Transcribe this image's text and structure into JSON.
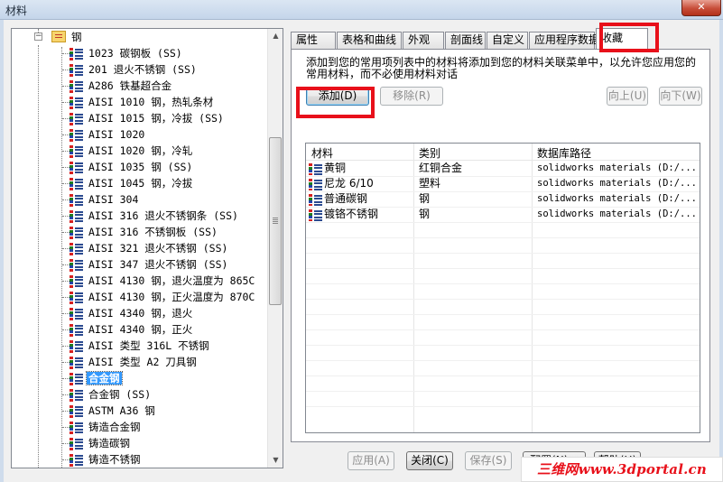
{
  "window": {
    "title": "材料",
    "close_glyph": "✕"
  },
  "tree": {
    "root": {
      "label": "钢",
      "icon": "folder-icon"
    },
    "items": [
      "1023 碳钢板 (SS)",
      "201 退火不锈钢 (SS)",
      "A286 铁基超合金",
      "AISI 1010 钢，热轧条材",
      "AISI 1015 钢，冷拔 (SS)",
      "AISI 1020",
      "AISI 1020 钢，冷轧",
      "AISI 1035 钢 (SS)",
      "AISI 1045 钢，冷拔",
      "AISI 304",
      "AISI 316 退火不锈钢条 (SS)",
      "AISI 316 不锈钢板 (SS)",
      "AISI 321 退火不锈钢 (SS)",
      "AISI 347 退火不锈钢 (SS)",
      "AISI 4130 钢，退火温度为 865C",
      "AISI 4130 钢，正火温度为 870C",
      "AISI 4340 钢，退火",
      "AISI 4340 钢，正火",
      "AISI 类型 316L 不锈钢",
      "AISI 类型 A2 刀具钢",
      "合金钢",
      "合金钢 (SS)",
      "ASTM A36 钢",
      "铸造合金钢",
      "铸造碳钢",
      "铸造不锈钢"
    ],
    "selected_index": 20,
    "expander_glyph": "−",
    "scroll_up": "▲",
    "scroll_down": "▼"
  },
  "tabs": [
    {
      "label": "属性",
      "active": false
    },
    {
      "label": "表格和曲线",
      "active": false
    },
    {
      "label": "外观",
      "active": false
    },
    {
      "label": "剖面线",
      "active": false
    },
    {
      "label": "自定义",
      "active": false
    },
    {
      "label": "应用程序数据",
      "active": false
    },
    {
      "label": "收藏",
      "active": true
    }
  ],
  "favorites": {
    "description": "添加到您的常用项列表中的材料将添加到您的材料关联菜单中，以允许您应用您的常用材料，而不必使用材料对话",
    "buttons": {
      "add": "添加(D)",
      "remove": "移除(R)",
      "up": "向上(U)",
      "down": "向下(W)"
    },
    "columns": [
      "材料",
      "类别",
      "数据库路径"
    ],
    "rows": [
      {
        "material": "黄铜",
        "category": "红铜合金",
        "path": "solidworks materials (D:/..."
      },
      {
        "material": "尼龙 6/10",
        "category": "塑料",
        "path": "solidworks materials (D:/..."
      },
      {
        "material": "普通碳钢",
        "category": "钢",
        "path": "solidworks materials (D:/..."
      },
      {
        "material": "镀铬不锈钢",
        "category": "钢",
        "path": "solidworks materials (D:/..."
      }
    ]
  },
  "footer": {
    "apply": "应用(A)",
    "close": "关闭(C)",
    "save": "保存(S)",
    "config": "配置(N)...",
    "help": "帮助(H)"
  },
  "watermark": "三维网www.3dportal.cn",
  "colors": {
    "highlight_box": "#e8101a",
    "selection": "#3399ff"
  }
}
